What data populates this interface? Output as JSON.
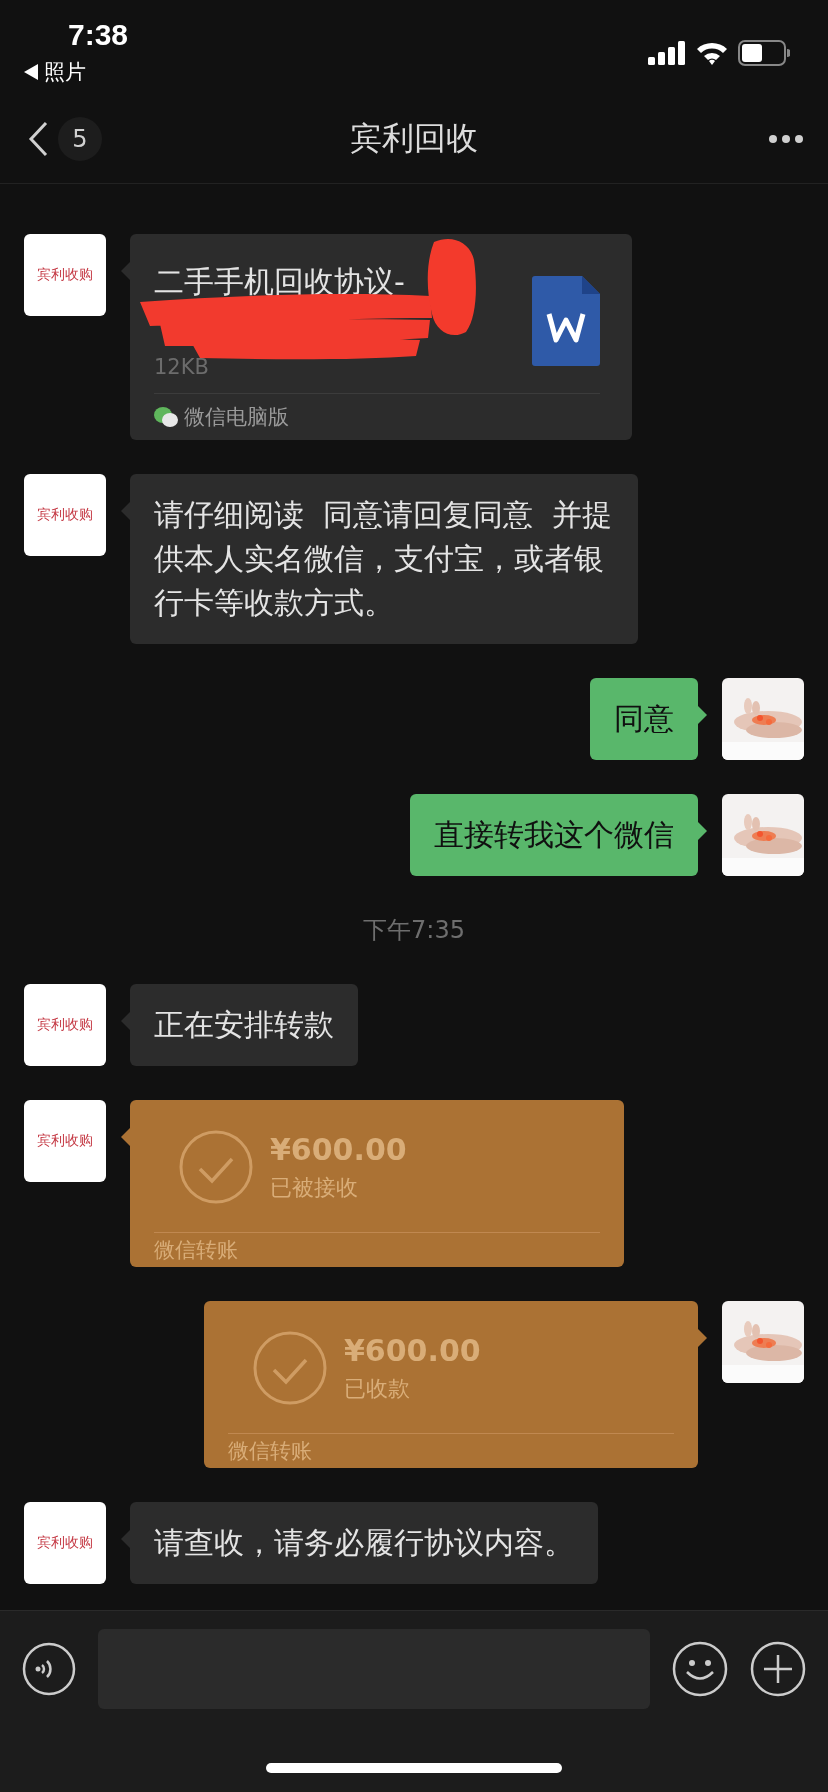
{
  "status_bar": {
    "time": "7:38",
    "back_app": "照片"
  },
  "header": {
    "title": "宾利回收",
    "unread": "5"
  },
  "messages": [
    {
      "kind": "file",
      "outgoing": false,
      "avatar": "宾利收购",
      "name": "二手手机回收协议-",
      "size": "12KB",
      "source": "微信电脑版"
    },
    {
      "kind": "text",
      "outgoing": false,
      "avatar": "宾利收购",
      "text": "请仔细阅读  同意请回复同意  并提供本人实名微信，支付宝，或者银行卡等收款方式。"
    },
    {
      "kind": "text",
      "outgoing": true,
      "text": "同意"
    },
    {
      "kind": "text",
      "outgoing": true,
      "text": "直接转我这个微信"
    },
    {
      "kind": "time",
      "text": "下午7:35"
    },
    {
      "kind": "text",
      "outgoing": false,
      "avatar": "宾利收购",
      "text": "正在安排转款"
    },
    {
      "kind": "transfer",
      "outgoing": false,
      "avatar": "宾利收购",
      "amount": "¥600.00",
      "status": "已被接收",
      "footer": "微信转账"
    },
    {
      "kind": "transfer",
      "outgoing": true,
      "amount": "¥600.00",
      "status": "已收款",
      "footer": "微信转账"
    },
    {
      "kind": "text",
      "outgoing": false,
      "avatar": "宾利收购",
      "text": "请查收，请务必履行协议内容。"
    }
  ]
}
